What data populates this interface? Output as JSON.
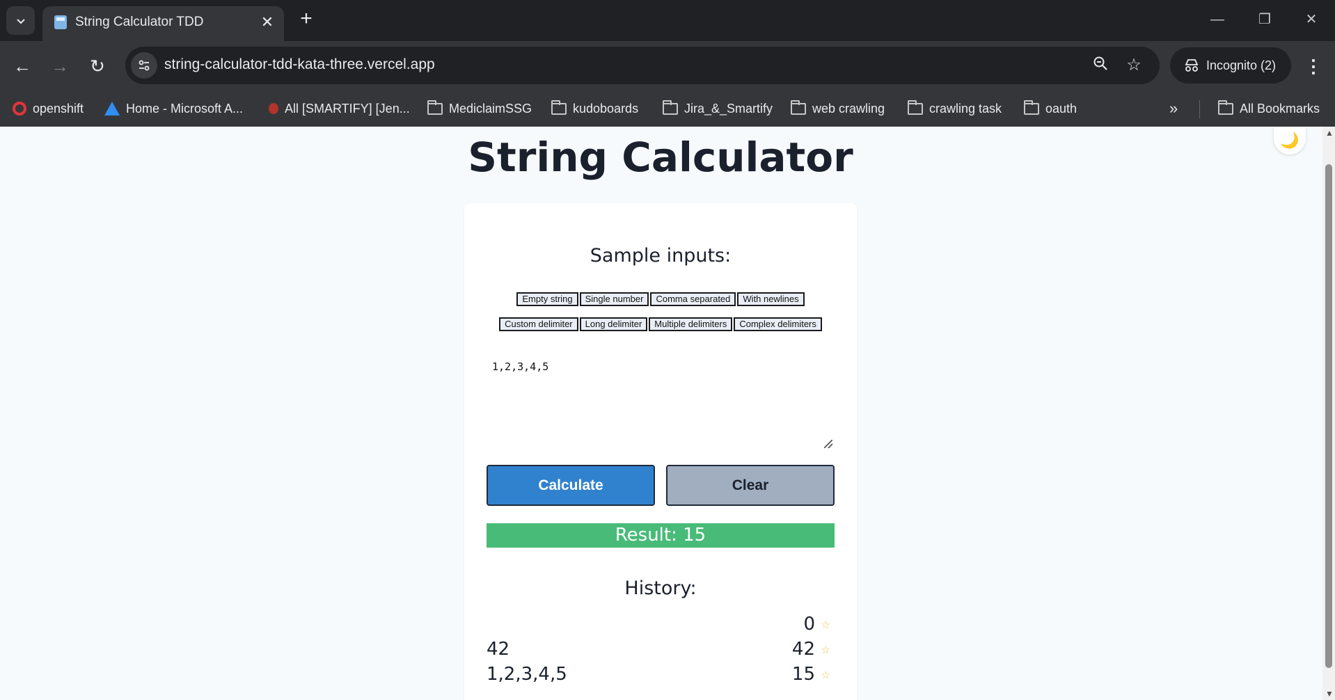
{
  "browser": {
    "tab_title": "String Calculator TDD",
    "url": "string-calculator-tdd-kata-three.vercel.app",
    "incognito_label": "Incognito (2)",
    "bookmarks": [
      "openshift",
      "Home - Microsoft A...",
      "All [SMARTIFY] [Jen...",
      "MediclaimSSG",
      "kudoboards",
      "Jira_&_Smartify",
      "web crawling",
      "crawling task",
      "oauth"
    ],
    "all_bookmarks_label": "All Bookmarks"
  },
  "page": {
    "title": "String Calculator",
    "samples_heading": "Sample inputs:",
    "sample_buttons_row1": [
      "Empty string",
      "Single number",
      "Comma separated",
      "With newlines"
    ],
    "sample_buttons_row2": [
      "Custom delimiter",
      "Long delimiter",
      "Multiple delimiters",
      "Complex delimiters"
    ],
    "input_value": "1,2,3,4,5",
    "calculate_label": "Calculate",
    "clear_label": "Clear",
    "result_text": "Result: 15",
    "history_heading": "History:",
    "history": [
      {
        "input": "",
        "result": "0"
      },
      {
        "input": "42",
        "result": "42"
      },
      {
        "input": "1,2,3,4,5",
        "result": "15"
      }
    ]
  },
  "colors": {
    "primary": "#3182ce",
    "secondary": "#a0aec0",
    "success": "#48bb78",
    "star": "#ecc94b"
  }
}
